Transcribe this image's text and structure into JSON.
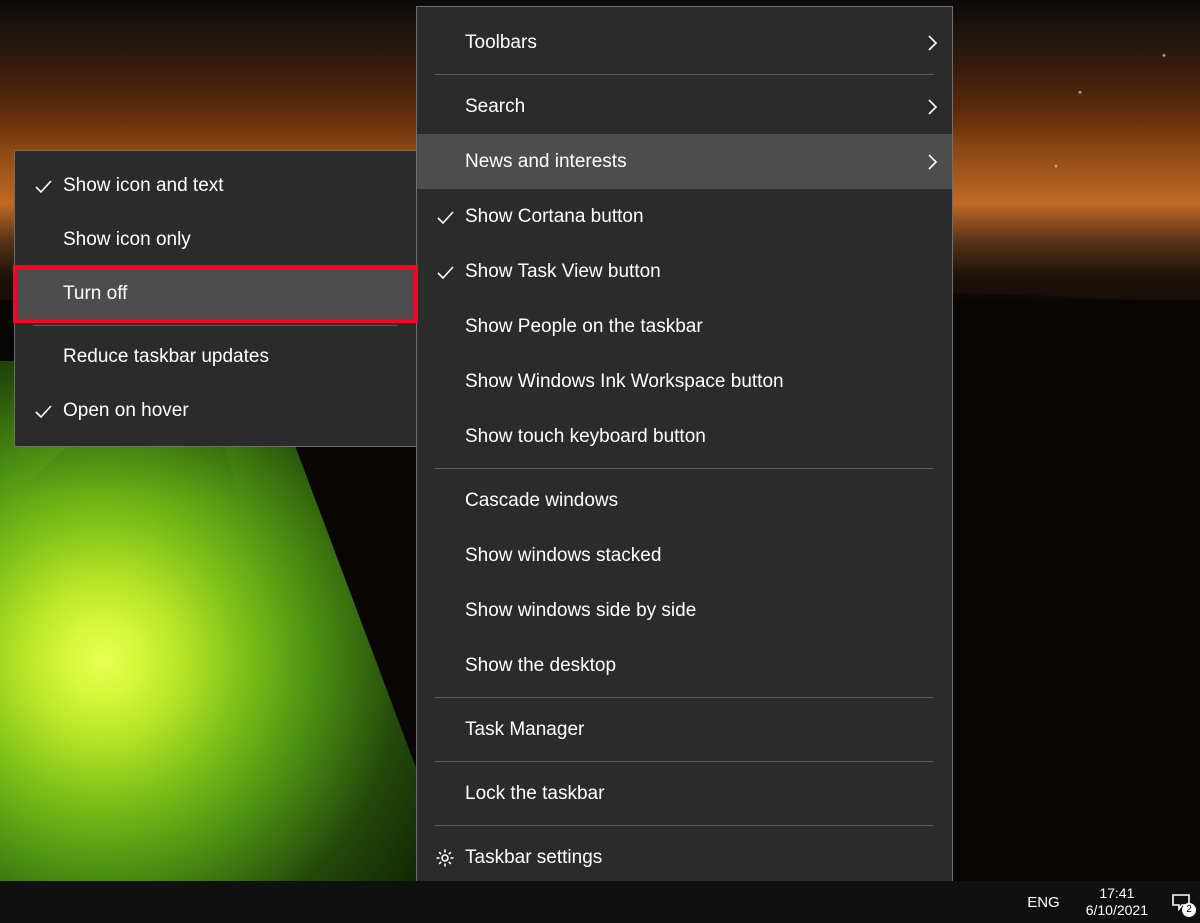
{
  "main_menu": {
    "items": [
      {
        "label": "Toolbars",
        "submenu": true,
        "checked": false
      },
      {
        "label": "Search",
        "submenu": true,
        "checked": false
      },
      {
        "label": "News and interests",
        "submenu": true,
        "checked": false,
        "hover": true
      },
      {
        "label": "Show Cortana button",
        "submenu": false,
        "checked": true
      },
      {
        "label": "Show Task View button",
        "submenu": false,
        "checked": true
      },
      {
        "label": "Show People on the taskbar",
        "submenu": false,
        "checked": false
      },
      {
        "label": "Show Windows Ink Workspace button",
        "submenu": false,
        "checked": false
      },
      {
        "label": "Show touch keyboard button",
        "submenu": false,
        "checked": false
      },
      {
        "label": "Cascade windows",
        "submenu": false,
        "checked": false
      },
      {
        "label": "Show windows stacked",
        "submenu": false,
        "checked": false
      },
      {
        "label": "Show windows side by side",
        "submenu": false,
        "checked": false
      },
      {
        "label": "Show the desktop",
        "submenu": false,
        "checked": false
      },
      {
        "label": "Task Manager",
        "submenu": false,
        "checked": false
      },
      {
        "label": "Lock the taskbar",
        "submenu": false,
        "checked": false
      },
      {
        "label": "Taskbar settings",
        "submenu": false,
        "checked": false,
        "icon": "gear"
      }
    ]
  },
  "sub_menu": {
    "items": [
      {
        "label": "Show icon and text",
        "checked": true
      },
      {
        "label": "Show icon only",
        "checked": false
      },
      {
        "label": "Turn off",
        "checked": false,
        "highlight": true
      },
      {
        "label": "Reduce taskbar updates",
        "checked": false
      },
      {
        "label": "Open on hover",
        "checked": true
      }
    ]
  },
  "taskbar": {
    "language": "ENG",
    "time": "17:41",
    "date": "6/10/2021",
    "notification_count": "2"
  }
}
